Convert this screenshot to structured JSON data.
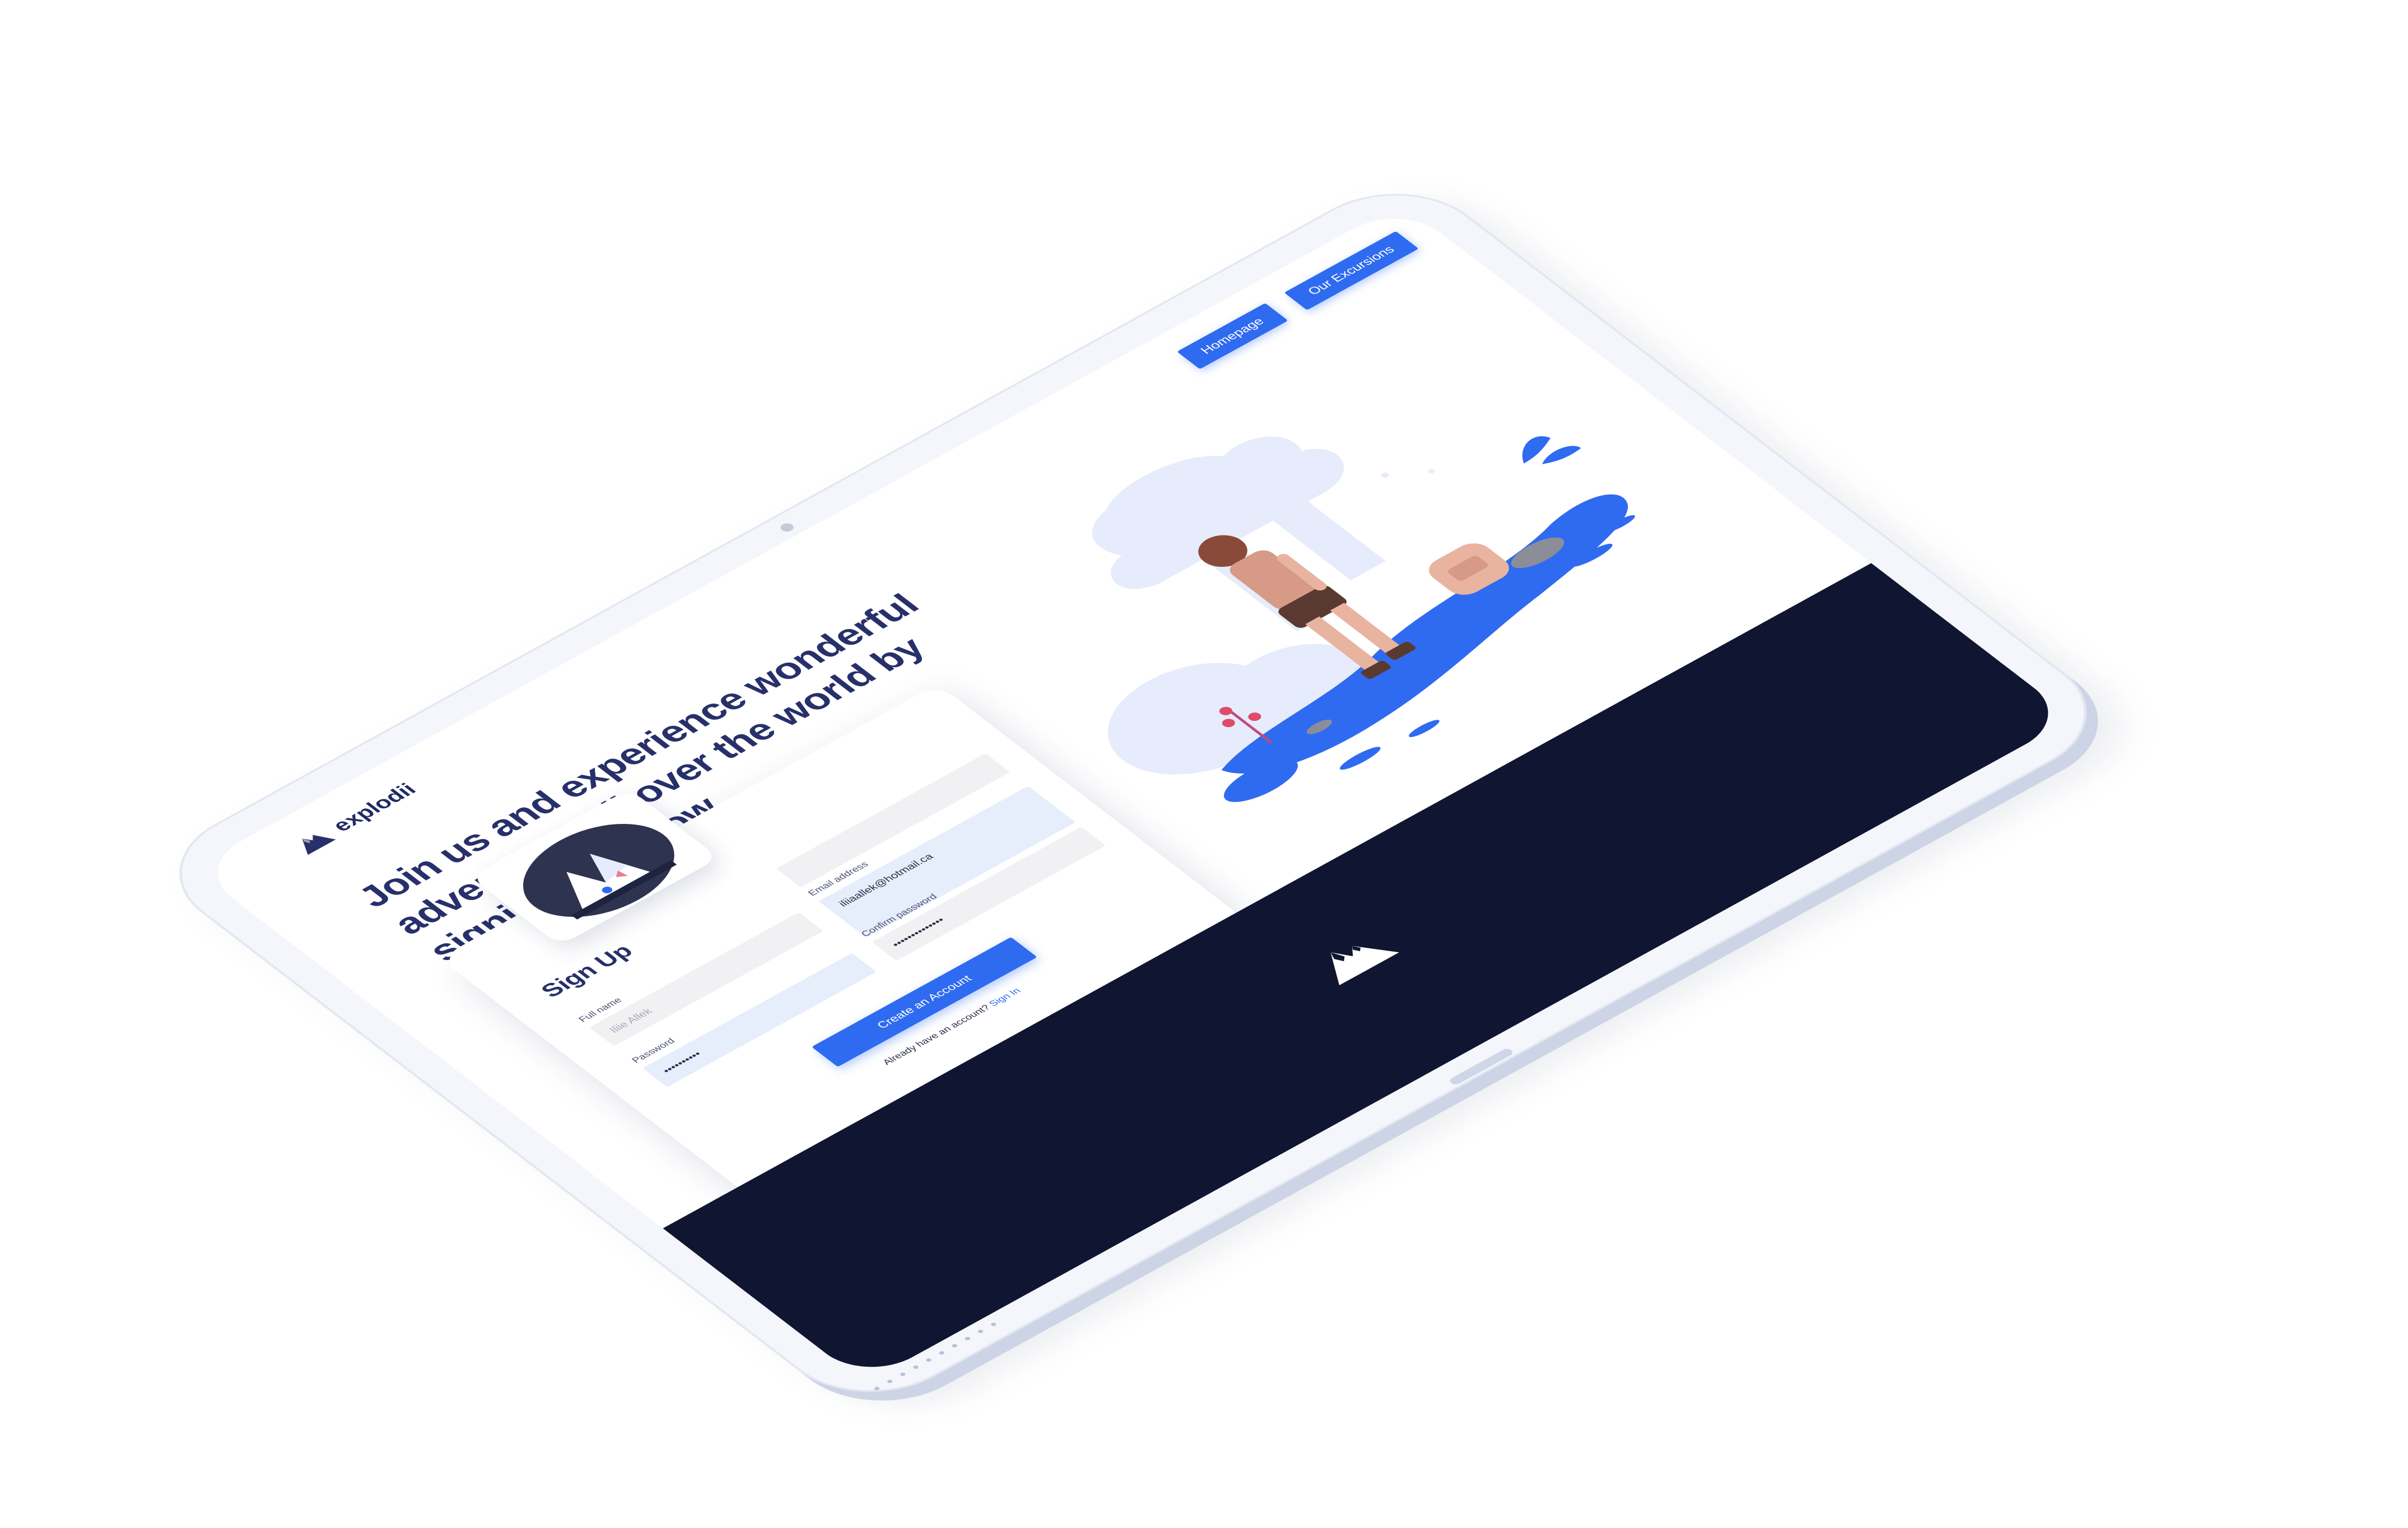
{
  "brand": {
    "name": "explodii",
    "logo_icon": "mountain-logo-icon"
  },
  "nav": {
    "homepage_label": "Homepage",
    "excursions_label": "Our Excursions"
  },
  "hero": {
    "title": "Join us and experience wonderful adventures all over the world by signing up below"
  },
  "signup": {
    "title": "Sign Up",
    "full_name": {
      "label": "Full name",
      "placeholder": "Iliie Allek"
    },
    "email": {
      "label": "Email address",
      "value": "iliiaallek@hotmail.ca"
    },
    "password": {
      "label": "Password",
      "value": "••••••••••"
    },
    "confirm_password": {
      "label": "Confirm password",
      "value": "••••••••••••••"
    },
    "submit_label": "Create an Account",
    "signin_prompt": "Already have an account?",
    "signin_link": "Sign In"
  },
  "colors": {
    "accent": "#2f6bf0",
    "title": "#27306a",
    "footer": "#101531",
    "illustration_light": "#e6ecfb"
  },
  "illustration": {
    "icon": "hiker-woman-with-backpack-illustration"
  }
}
